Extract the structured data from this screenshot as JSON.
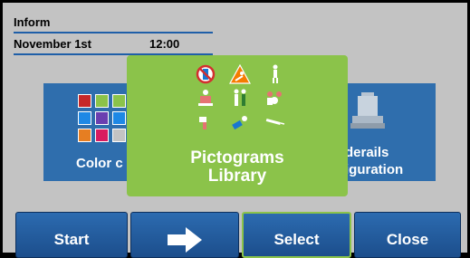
{
  "header": {
    "title": "Inform",
    "date": "November 1st",
    "time": "12:00"
  },
  "tiles": {
    "color": {
      "label_line1": "Color c"
    },
    "siderails": {
      "label_line1": "derails",
      "label_line2": "iguration"
    }
  },
  "popup": {
    "title_line1": "Pictograms",
    "title_line2": "Library",
    "background": "#8bc34a"
  },
  "swatches": [
    "#c62828",
    "#8bc34a",
    "#8bc34a",
    "#1e88e5",
    "#6a3fb0",
    "#1e88e5",
    "#e67e22",
    "#d81b60",
    "#c3c3c3"
  ],
  "buttons": {
    "start": "Start",
    "next_icon": "arrow-right-icon",
    "select": "Select",
    "close": "Close"
  },
  "colors": {
    "button_blue": "#2c6bb0",
    "tile_blue": "#2f6ead",
    "accent_line": "#1f5fa8"
  }
}
